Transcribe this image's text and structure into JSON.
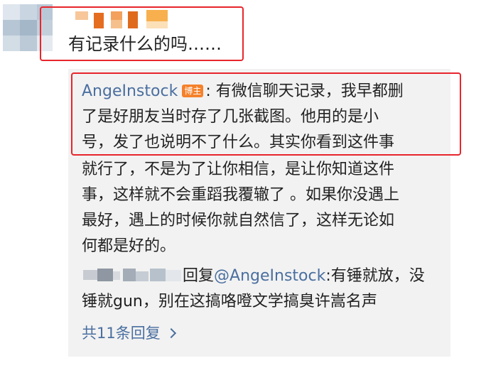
{
  "comment": {
    "text": "有记录什么的吗……"
  },
  "reply": {
    "author": "AngeInstock",
    "badge": "博主",
    "line1_rest": ": 有微信聊天记录，我早都删",
    "line2": "了是好朋友当时存了几张截图。他用的是小",
    "line3": "号，发了也说明不了什么。其实你看到这件事",
    "line4": "就行了，不是为了让你相信，是让你知道这件",
    "line5": "事，这样就不会重蹈我覆辙了 。如果你没遇上",
    "line6": "最好，遇上的时候你就自然信了，这样无论如",
    "line7": "何都是好的。"
  },
  "sub_reply": {
    "reply_word": "回复",
    "mention": "@AngeInstock",
    "line1_rest": ":有锤就放，没",
    "line2": "锤就gun，别在这搞咯噔文学搞臭许嵩名声"
  },
  "more_replies": {
    "label": "共11条回复"
  },
  "colors": {
    "highlight": "#e8252c",
    "link": "#4a6fa0",
    "badge": "#f5812b",
    "panel": "#f2f2f2"
  },
  "icons": [
    "chevron-right-icon"
  ]
}
